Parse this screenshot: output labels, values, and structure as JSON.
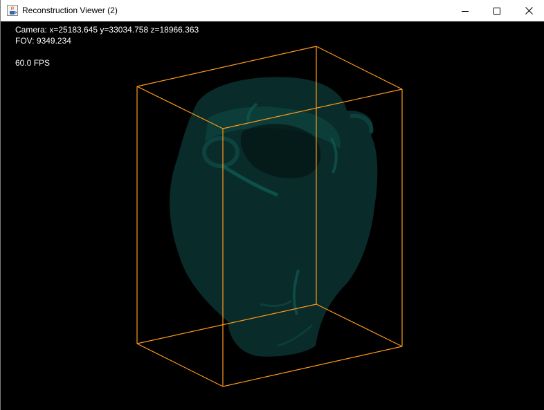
{
  "window": {
    "title": "Reconstruction Viewer (2)",
    "icon": "java-cup-icon"
  },
  "controls": {
    "minimize_icon": "minimize-icon",
    "maximize_icon": "maximize-icon",
    "close_icon": "close-icon"
  },
  "hud": {
    "camera": "Camera: x=25183.645 y=33034.758 z=18966.363",
    "fov": "FOV: 9349.234",
    "fps": "60.0 FPS"
  },
  "colors": {
    "background": "#000000",
    "bounding_box": "#ff9a1a",
    "mesh_fill": "#0a2f2c",
    "mesh_highlight": "#0f4a45"
  }
}
